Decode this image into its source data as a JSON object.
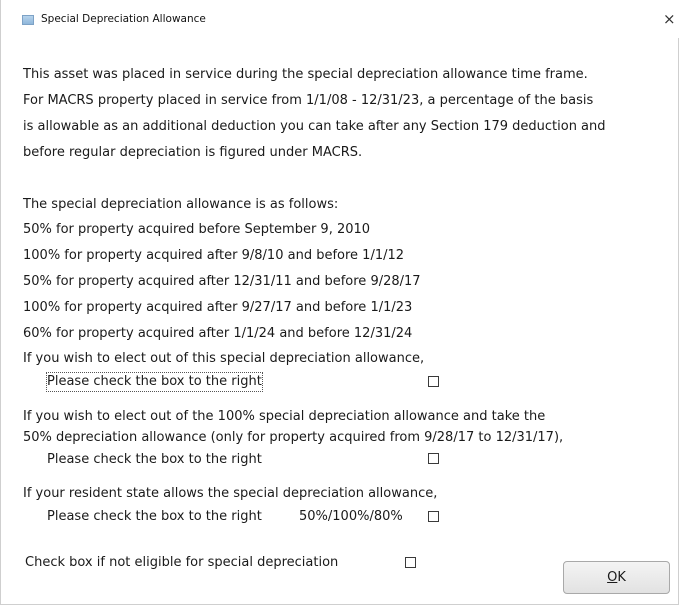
{
  "window": {
    "title": "Special Depreciation Allowance",
    "close_glyph": "×"
  },
  "intro": {
    "line1": "This asset was placed in service during the special depreciation allowance time frame.",
    "line2": "For MACRS property placed in service from 1/1/08 - 12/31/23, a percentage of the basis",
    "line3": "is allowable as an additional deduction you can take after any Section 179 deduction and",
    "line4": "before regular depreciation is figured under MACRS."
  },
  "allowances": {
    "heading": "The special depreciation allowance is as follows:",
    "items": [
      "50% for property acquired before September 9, 2010",
      "100% for property acquired after 9/8/10 and before 1/1/12",
      "50% for property acquired after 12/31/11 and before 9/28/17",
      "100% for property acquired after 9/27/17 and before 1/1/23",
      "60% for property acquired after 1/1/24 and before 12/31/24"
    ]
  },
  "elect_out": {
    "line1": "If you wish to elect out of this special depreciation allowance,",
    "check_label": "Please check the box to the right",
    "checked": false
  },
  "elect_50": {
    "line1": "If you wish to elect out of the 100% special depreciation allowance and take the",
    "line2": "50% depreciation allowance (only for property acquired from 9/28/17 to 12/31/17),",
    "check_label": "Please check the box to the right",
    "checked": false
  },
  "resident_state": {
    "line1": "If your resident state allows the special depreciation allowance,",
    "check_label": "Please check the box to the right",
    "rate_label": "50%/100%/80%",
    "checked": false
  },
  "not_eligible": {
    "check_label": "Check box if not eligible for special depreciation",
    "checked": false
  },
  "buttons": {
    "ok_label": "OK",
    "ok_mnemonic": "O"
  }
}
